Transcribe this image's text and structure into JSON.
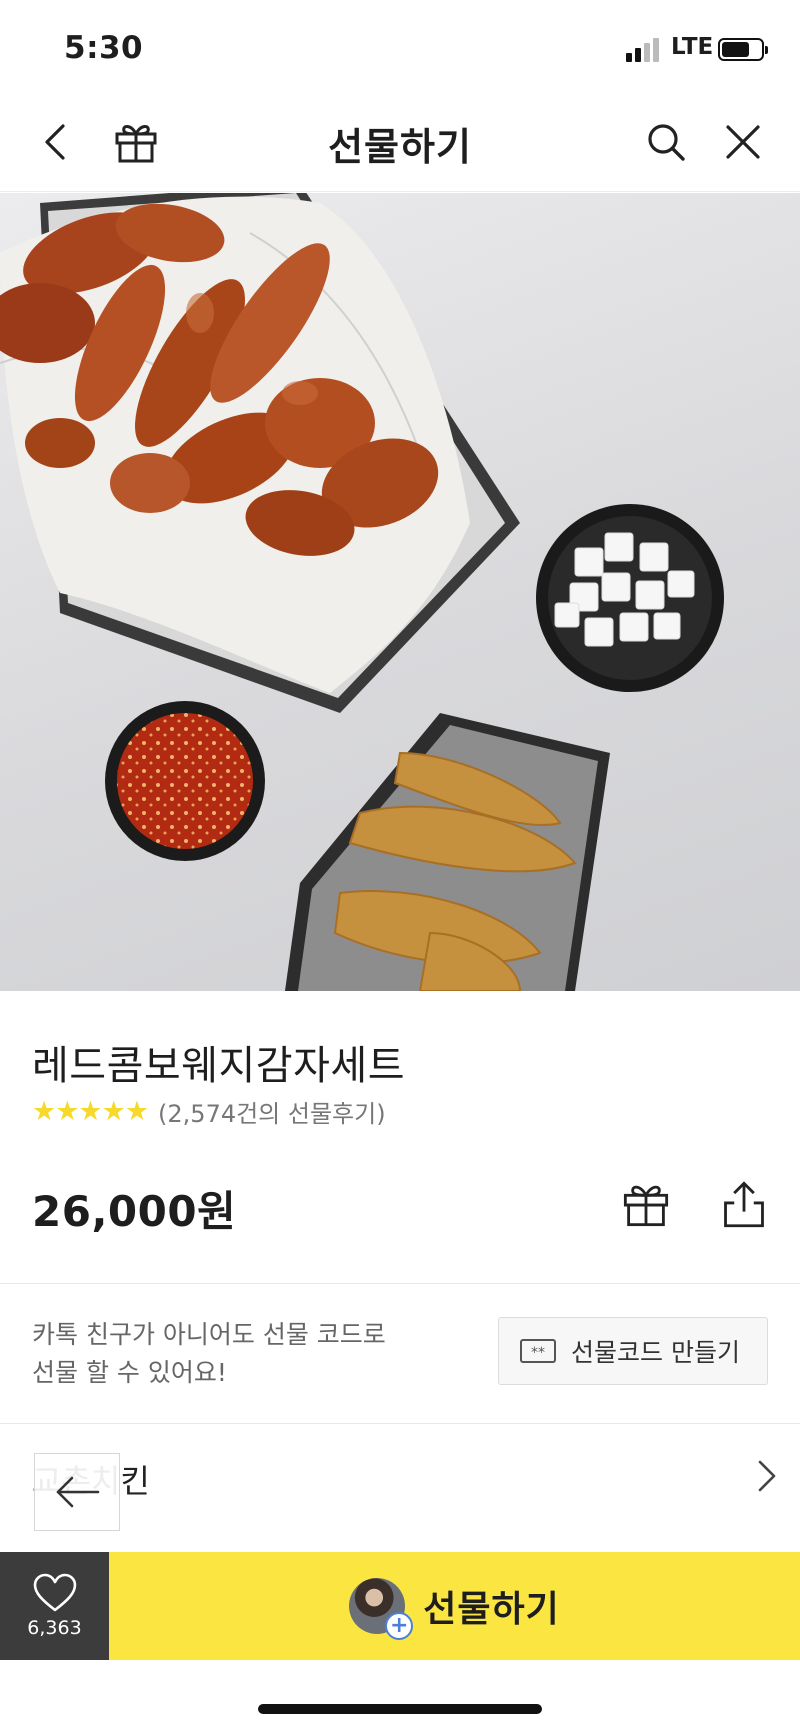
{
  "status_bar": {
    "time": "5:30",
    "network": "LTE",
    "battery_level": 0.72
  },
  "navbar": {
    "title": "선물하기"
  },
  "product": {
    "name": "레드콤보웨지감자세트",
    "rating_stars": "★★★★★",
    "rating": 5,
    "review_count_text": "(2,574건의 선물후기)",
    "price": "26,000원"
  },
  "gift_code": {
    "message_line1": "카톡 친구가 아니어도 선물 코드로",
    "message_line2": "선물 할 수 있어요!",
    "button_label": "선물코드 만들기"
  },
  "brand": {
    "name": "교촌치킨"
  },
  "bottom_bar": {
    "like_count": "6,363",
    "gift_label": "선물하기"
  },
  "colors": {
    "accent": "#fbe641",
    "like_bg": "#3c3c3c",
    "star": "#f7d92c"
  }
}
